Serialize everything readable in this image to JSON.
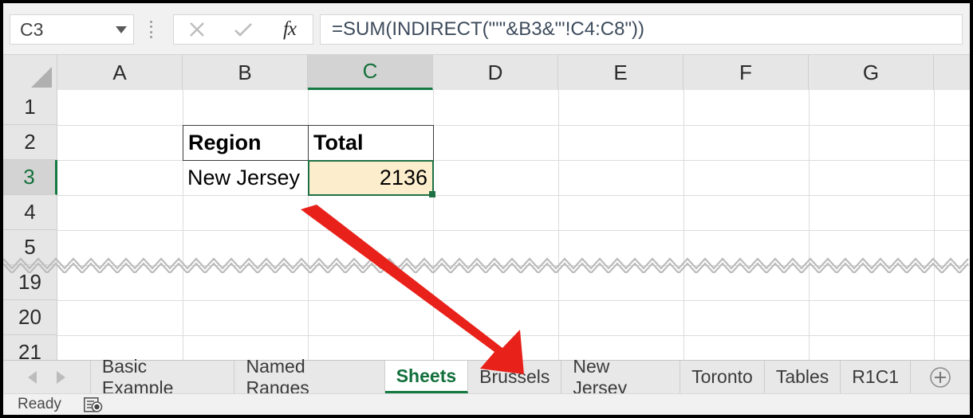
{
  "formula_bar": {
    "name_box_value": "C3",
    "dropdown_icon": "chevron-down-icon",
    "grip_icon": "grip-dots-icon",
    "cancel_icon": "close-x-icon",
    "confirm_icon": "checkmark-icon",
    "function_icon": "fx-insert-function-icon",
    "formula_value": "=SUM(INDIRECT(\"'\"&B3&\"'!C4:C8\"))"
  },
  "grid": {
    "select_all_icon": "select-all-corner-icon",
    "columns": [
      "A",
      "B",
      "C",
      "D",
      "E",
      "F",
      "G"
    ],
    "selected_column": "C",
    "rows": [
      "1",
      "2",
      "3",
      "4",
      "5",
      "19",
      "20",
      "21"
    ],
    "selected_row": "3",
    "break_indicator": "row-break-zigzag",
    "cells": {
      "b2": "Region",
      "c2": "Total",
      "b3": "New Jersey",
      "c3": "2136"
    },
    "active_cell": "C3"
  },
  "annotation": {
    "arrow_icon": "red-arrow-pointer",
    "arrow_color": "#E8211A",
    "points_to": "New Jersey"
  },
  "tab_bar": {
    "first_nav_icon": "nav-previous-icon",
    "next_nav_icon": "nav-next-icon",
    "tabs": [
      {
        "label": "Basic Example",
        "active": false
      },
      {
        "label": "Named Ranges",
        "active": false
      },
      {
        "label": "Sheets",
        "active": true
      },
      {
        "label": "Brussels",
        "active": false
      },
      {
        "label": "New Jersey",
        "active": false
      },
      {
        "label": "Toronto",
        "active": false
      },
      {
        "label": "Tables",
        "active": false
      },
      {
        "label": "R1C1",
        "active": false
      }
    ],
    "add_sheet_icon": "add-sheet-plus-icon"
  },
  "status_bar": {
    "status_text": "Ready",
    "macro_icon": "record-macro-icon"
  },
  "colors": {
    "accent_green": "#147A42",
    "selected_cell_fill": "#FCEECD",
    "annotation_red": "#E8211A",
    "header_gray": "#E6E6E6"
  }
}
